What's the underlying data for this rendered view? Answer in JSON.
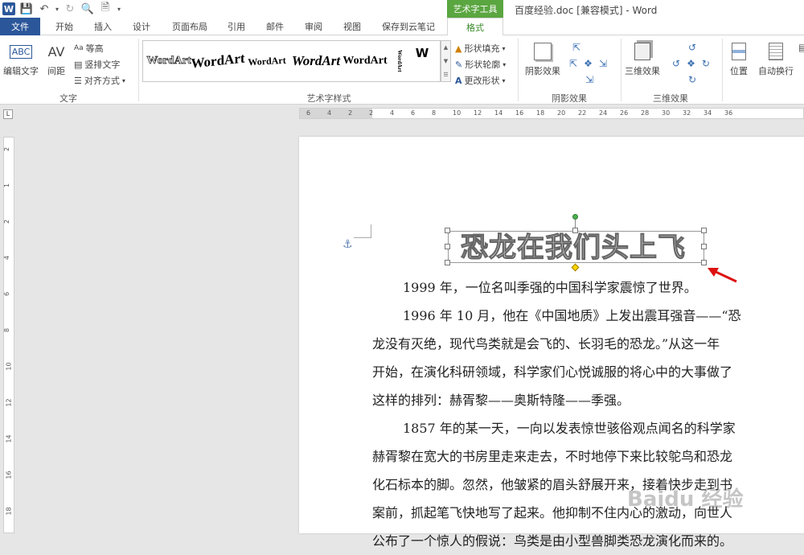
{
  "app": {
    "doc_title": "百度经验.doc [兼容模式] - Word",
    "context_tab_group": "艺术字工具"
  },
  "tabs": [
    "文件",
    "开始",
    "插入",
    "设计",
    "页面布局",
    "引用",
    "邮件",
    "审阅",
    "视图",
    "保存到云笔记",
    "格式"
  ],
  "ribbon": {
    "text_group": {
      "label": "文字",
      "edit_text": "编辑文字",
      "spacing": "间距",
      "even_height": "等高",
      "vertical_text": "竖排文字",
      "align_text": "对齐方式"
    },
    "wordart_group": {
      "label": "艺术字样式",
      "samples": [
        "WordArt",
        "WordArt",
        "WordArt",
        "WordArt",
        "WordArt",
        "WordArt",
        "W"
      ],
      "shape_fill": "形状填充",
      "shape_outline": "形状轮廓",
      "change_shape": "更改形状"
    },
    "shadow_group": {
      "label": "阴影效果",
      "shadow_effects": "阴影效果"
    },
    "threed_group": {
      "label": "三维效果",
      "threed_effects": "三维效果"
    },
    "arrange": {
      "position": "位置",
      "wrap_text": "自动换行"
    }
  },
  "ruler": {
    "h_ticks": [
      "6",
      "4",
      "2",
      "2",
      "4",
      "6",
      "8",
      "10",
      "12",
      "14",
      "16",
      "18",
      "20",
      "22",
      "24",
      "26",
      "28",
      "30",
      "32",
      "34",
      "36"
    ],
    "v_ticks": [
      "2",
      "1",
      "2",
      "4",
      "6",
      "8",
      "10",
      "12",
      "14",
      "16",
      "18"
    ]
  },
  "document": {
    "wordart_title": "恐龙在我们头上飞",
    "lines": [
      "1999 年，一位名叫季强的中国科学家震惊了世界。",
      "1996 年 10 月，他在《中国地质》上发出震耳强音——“恐",
      "龙没有灭绝，现代鸟类就是会飞的、长羽毛的恐龙。”从这一年",
      "开始，在演化科研领域，科学家们心悦诚服的将心中的大事做了",
      "这样的排列：赫胥黎——奥斯特隆——季强。",
      "1857 年的某一天，一向以发表惊世骇俗观点闻名的科学家",
      "赫胥黎在宽大的书房里走来走去，不时地停下来比较鸵鸟和恐龙",
      "化石标本的脚。忽然，他皱紧的眉头舒展开来，接着快步走到书",
      "案前，抓起笔飞快地写了起来。他抑制不住内心的激动，向世人",
      "公布了一个惊人的假说：鸟类是由小型兽脚类恐龙演化而来的。"
    ]
  },
  "watermark": "Baidu 经验",
  "colors": {
    "word_blue": "#2b579a",
    "context_green": "#5aa640"
  }
}
